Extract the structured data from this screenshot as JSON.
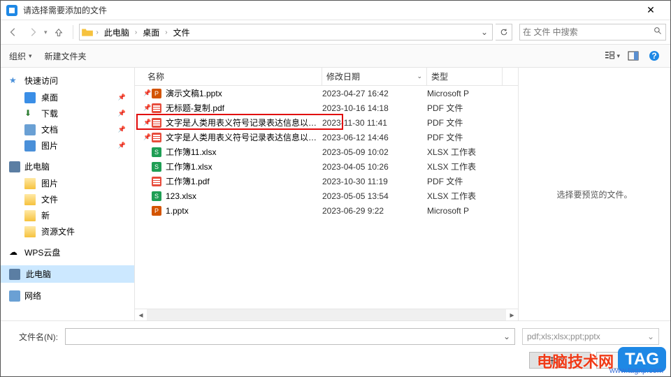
{
  "window": {
    "title": "请选择需要添加的文件"
  },
  "breadcrumb": {
    "items": [
      "此电脑",
      "桌面",
      "文件"
    ]
  },
  "search": {
    "placeholder": "在 文件 中搜索"
  },
  "toolbar": {
    "organize": "组织",
    "newfolder": "新建文件夹"
  },
  "sidebar": {
    "quick": {
      "label": "快速访问",
      "items": [
        "桌面",
        "下载",
        "文档",
        "图片"
      ]
    },
    "thispc": {
      "label": "此电脑",
      "items": [
        "图片",
        "文件",
        "新",
        "资源文件"
      ]
    },
    "wps": {
      "label": "WPS云盘"
    },
    "thispc2": {
      "label": "此电脑"
    },
    "network": {
      "label": "网络"
    }
  },
  "columns": {
    "name": "名称",
    "date": "修改日期",
    "type": "类型"
  },
  "files": [
    {
      "icon": "ppt",
      "pin": true,
      "name": "演示文稿1.pptx",
      "date": "2023-04-27 16:42",
      "type": "Microsoft P"
    },
    {
      "icon": "pdf",
      "pin": true,
      "name": "无标题-复制.pdf",
      "date": "2023-10-16 14:18",
      "type": "PDF 文件"
    },
    {
      "icon": "pdf",
      "pin": true,
      "name": "文字是人类用表义符号记录表达信息以传...",
      "date": "2023-11-30 11:41",
      "type": "PDF 文件"
    },
    {
      "icon": "pdf",
      "pin": true,
      "name": "文字是人类用表义符号记录表达信息以传...",
      "date": "2023-06-12 14:46",
      "type": "PDF 文件"
    },
    {
      "icon": "xlsx",
      "pin": false,
      "name": "工作簿11.xlsx",
      "date": "2023-05-09 10:02",
      "type": "XLSX 工作表"
    },
    {
      "icon": "xlsx",
      "pin": false,
      "name": "工作簿1.xlsx",
      "date": "2023-04-05 10:26",
      "type": "XLSX 工作表"
    },
    {
      "icon": "pdf",
      "pin": false,
      "name": "工作簿1.pdf",
      "date": "2023-10-30 11:19",
      "type": "PDF 文件"
    },
    {
      "icon": "xlsx",
      "pin": false,
      "name": "123.xlsx",
      "date": "2023-05-05 13:54",
      "type": "XLSX 工作表"
    },
    {
      "icon": "ppt",
      "pin": false,
      "name": "1.pptx",
      "date": "2023-06-29 9:22",
      "type": "Microsoft P"
    }
  ],
  "preview": {
    "empty": "选择要预览的文件。"
  },
  "footer": {
    "filename_label": "文件名(N):",
    "filter": "pdf;xls;xlsx;ppt;pptx",
    "open": "打开(O)",
    "cancel": "取消"
  },
  "watermark": {
    "text": "电脑技术网",
    "url": "www.tagxp.com",
    "tag": "TAG"
  }
}
